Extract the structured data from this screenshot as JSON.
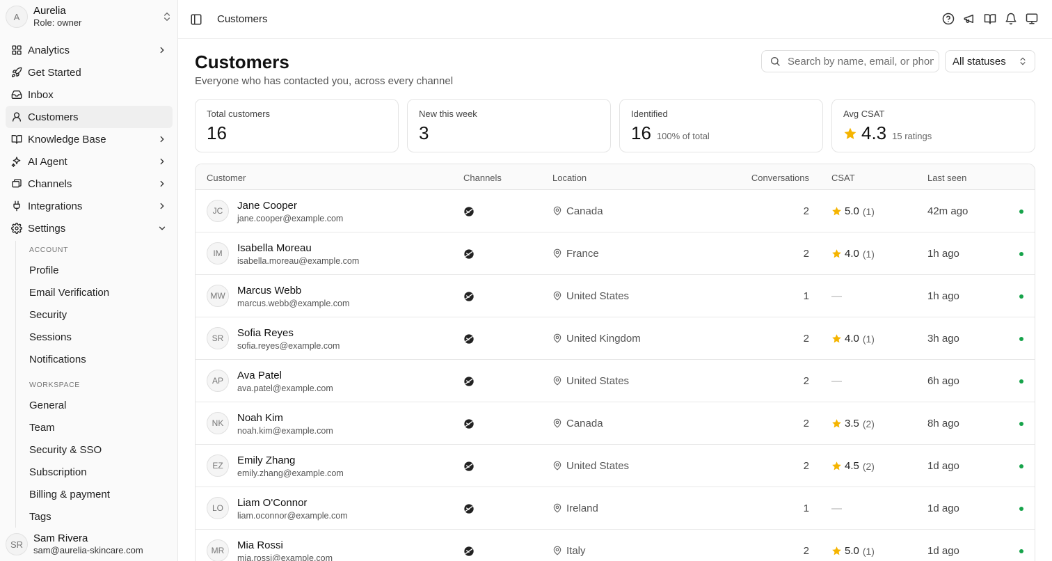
{
  "workspace": {
    "initial": "A",
    "name": "Aurelia",
    "role": "Role: owner"
  },
  "nav": [
    {
      "label": "Analytics",
      "icon": "grid-icon",
      "chevron": "right"
    },
    {
      "label": "Get Started",
      "icon": "rocket-icon",
      "chevron": ""
    },
    {
      "label": "Inbox",
      "icon": "inbox-icon",
      "chevron": ""
    },
    {
      "label": "Customers",
      "icon": "user-icon",
      "chevron": "",
      "active": true
    },
    {
      "label": "Knowledge Base",
      "icon": "book-icon",
      "chevron": "right"
    },
    {
      "label": "AI Agent",
      "icon": "sparkle-icon",
      "chevron": "right"
    },
    {
      "label": "Channels",
      "icon": "channels-icon",
      "chevron": "right"
    },
    {
      "label": "Integrations",
      "icon": "plug-icon",
      "chevron": "right"
    },
    {
      "label": "Settings",
      "icon": "gear-icon",
      "chevron": "down"
    }
  ],
  "settings": {
    "account_heading": "ACCOUNT",
    "account_items": [
      "Profile",
      "Email Verification",
      "Security",
      "Sessions",
      "Notifications"
    ],
    "workspace_heading": "WORKSPACE",
    "workspace_items": [
      "General",
      "Team",
      "Security & SSO",
      "Subscription",
      "Billing & payment",
      "Tags"
    ]
  },
  "user": {
    "initials": "SR",
    "name": "Sam Rivera",
    "email": "sam@aurelia-skincare.com"
  },
  "breadcrumb": "Customers",
  "page": {
    "title": "Customers",
    "subtitle": "Everyone who has contacted you, across every channel"
  },
  "search": {
    "placeholder": "Search by name, email, or phone",
    "value": ""
  },
  "status_filter": {
    "selected": "All statuses"
  },
  "stats": {
    "total": {
      "label": "Total customers",
      "value": "16"
    },
    "new": {
      "label": "New this week",
      "value": "3"
    },
    "identified": {
      "label": "Identified",
      "value": "16",
      "sub": "100% of total"
    },
    "csat": {
      "label": "Avg CSAT",
      "value": "4.3",
      "sub": "15 ratings"
    }
  },
  "table": {
    "headers": {
      "customer": "Customer",
      "channels": "Channels",
      "location": "Location",
      "conversations": "Conversations",
      "csat": "CSAT",
      "last_seen": "Last seen"
    },
    "rows": [
      {
        "initials": "JC",
        "name": "Jane Cooper",
        "email": "jane.cooper@example.com",
        "location": "Canada",
        "conversations": "2",
        "csat": "5.0",
        "csat_count": "(1)",
        "last_seen": "42m ago"
      },
      {
        "initials": "IM",
        "name": "Isabella Moreau",
        "email": "isabella.moreau@example.com",
        "location": "France",
        "conversations": "2",
        "csat": "4.0",
        "csat_count": "(1)",
        "last_seen": "1h ago"
      },
      {
        "initials": "MW",
        "name": "Marcus Webb",
        "email": "marcus.webb@example.com",
        "location": "United States",
        "conversations": "1",
        "csat": "—",
        "csat_count": "",
        "last_seen": "1h ago"
      },
      {
        "initials": "SR",
        "name": "Sofia Reyes",
        "email": "sofia.reyes@example.com",
        "location": "United Kingdom",
        "conversations": "2",
        "csat": "4.0",
        "csat_count": "(1)",
        "last_seen": "3h ago"
      },
      {
        "initials": "AP",
        "name": "Ava Patel",
        "email": "ava.patel@example.com",
        "location": "United States",
        "conversations": "2",
        "csat": "—",
        "csat_count": "",
        "last_seen": "6h ago"
      },
      {
        "initials": "NK",
        "name": "Noah Kim",
        "email": "noah.kim@example.com",
        "location": "Canada",
        "conversations": "2",
        "csat": "3.5",
        "csat_count": "(2)",
        "last_seen": "8h ago"
      },
      {
        "initials": "EZ",
        "name": "Emily Zhang",
        "email": "emily.zhang@example.com",
        "location": "United States",
        "conversations": "2",
        "csat": "4.5",
        "csat_count": "(2)",
        "last_seen": "1d ago"
      },
      {
        "initials": "LO",
        "name": "Liam O'Connor",
        "email": "liam.oconnor@example.com",
        "location": "Ireland",
        "conversations": "1",
        "csat": "—",
        "csat_count": "",
        "last_seen": "1d ago"
      },
      {
        "initials": "MR",
        "name": "Mia Rossi",
        "email": "mia.rossi@example.com",
        "location": "Italy",
        "conversations": "2",
        "csat": "5.0",
        "csat_count": "(1)",
        "last_seen": "1d ago"
      }
    ]
  },
  "colors": {
    "star": "#f5b400",
    "online": "#16a34a",
    "active_nav": "#efefef"
  }
}
